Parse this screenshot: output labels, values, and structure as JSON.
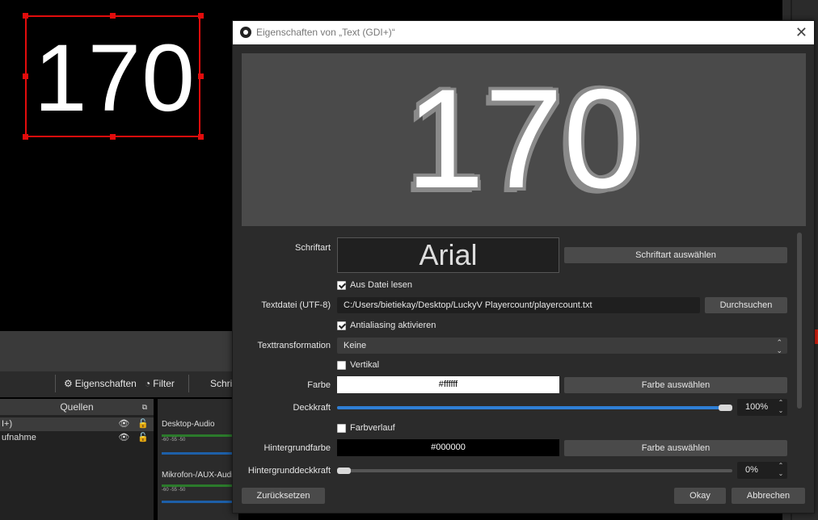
{
  "preview": {
    "text": "170"
  },
  "obs_main": {
    "toolbar": {
      "properties_label": "Eigenschaften",
      "filter_label": "Filter",
      "font_partial": "Schrif"
    },
    "sources": {
      "header": "Quellen",
      "items": [
        {
          "label": "I+)"
        },
        {
          "label": "ufnahme"
        }
      ]
    },
    "mixer": {
      "channels": [
        {
          "label": "Desktop-Audio",
          "scale": "-60   -55   -50"
        },
        {
          "label": "Mikrofon-/AUX-Audio",
          "scale": "-60   -55   -50"
        }
      ]
    }
  },
  "dialog": {
    "title": "Eigenschaften von „Text (GDI+)“",
    "preview_text": "170",
    "font": {
      "label": "Schriftart",
      "value": "Arial",
      "button": "Schriftart auswählen"
    },
    "read_from_file": {
      "label": "Aus Datei lesen",
      "checked": true
    },
    "text_file": {
      "label": "Textdatei (UTF-8)",
      "value": "C:/Users/bietiekay/Desktop/LuckyV Playercount/playercount.txt",
      "button": "Durchsuchen"
    },
    "antialiasing": {
      "label": "Antialiasing aktivieren",
      "checked": true
    },
    "transform": {
      "label": "Texttransformation",
      "value": "Keine"
    },
    "vertical": {
      "label": "Vertikal",
      "checked": false
    },
    "color": {
      "label": "Farbe",
      "value": "#ffffff",
      "button": "Farbe auswählen"
    },
    "opacity": {
      "label": "Deckkraft",
      "value": "100%",
      "level": 1.0
    },
    "gradient": {
      "label": "Farbverlauf",
      "checked": false
    },
    "bg_color": {
      "label": "Hintergrundfarbe",
      "value": "#000000",
      "button": "Farbe auswählen"
    },
    "bg_opacity": {
      "label": "Hintergrunddeckkraft",
      "value": "0%",
      "level": 0.0
    },
    "buttons": {
      "reset": "Zurücksetzen",
      "ok": "Okay",
      "cancel": "Abbrechen"
    }
  },
  "colors": {
    "selection": "#e20c0c",
    "slider_fill": "#2f7fd6",
    "dialog_bg": "#2b2b2b"
  }
}
